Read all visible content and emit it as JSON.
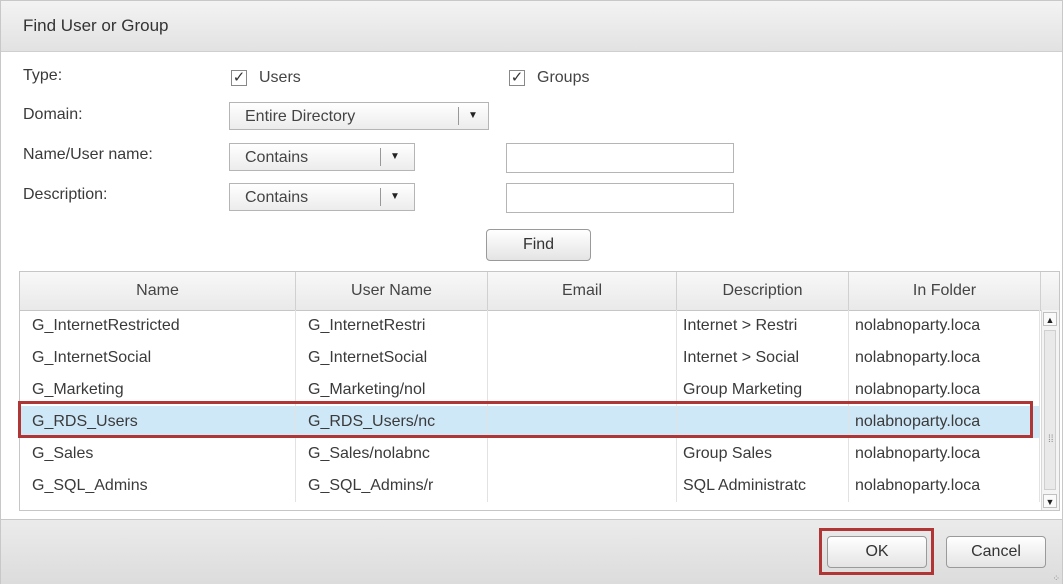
{
  "dialog": {
    "title": "Find User or Group"
  },
  "form": {
    "type_label": "Type:",
    "users_label": "Users",
    "users_checked": true,
    "groups_label": "Groups",
    "groups_checked": true,
    "domain_label": "Domain:",
    "domain_value": "Entire Directory",
    "name_label": "Name/User name:",
    "name_operator": "Contains",
    "name_value": "",
    "description_label": "Description:",
    "description_operator": "Contains",
    "description_value": "",
    "find_label": "Find",
    "checkmark": "✓",
    "dropdown_arrow": "▼"
  },
  "grid": {
    "columns": [
      "Name",
      "User Name",
      "Email",
      "Description",
      "In Folder"
    ],
    "rows": [
      {
        "name": "G_InternetRestricted",
        "user_name": "G_InternetRestri",
        "email": "",
        "description": "Internet > Restri",
        "folder": "nolabnoparty.loca",
        "selected": false
      },
      {
        "name": "G_InternetSocial",
        "user_name": "G_InternetSocial",
        "email": "",
        "description": "Internet > Social",
        "folder": "nolabnoparty.loca",
        "selected": false
      },
      {
        "name": "G_Marketing",
        "user_name": "G_Marketing/nol",
        "email": "",
        "description": "Group Marketing",
        "folder": "nolabnoparty.loca",
        "selected": false
      },
      {
        "name": "G_RDS_Users",
        "user_name": "G_RDS_Users/nc",
        "email": "",
        "description": "",
        "folder": "nolabnoparty.loca",
        "selected": true
      },
      {
        "name": "G_Sales",
        "user_name": "G_Sales/nolabnc",
        "email": "",
        "description": "Group Sales",
        "folder": "nolabnoparty.loca",
        "selected": false
      },
      {
        "name": "G_SQL_Admins",
        "user_name": "G_SQL_Admins/r",
        "email": "",
        "description": "SQL Administratc",
        "folder": "nolabnoparty.loca",
        "selected": false
      }
    ],
    "scroll_up": "▲",
    "scroll_down": "▼"
  },
  "footer": {
    "ok_label": "OK",
    "cancel_label": "Cancel"
  },
  "colors": {
    "selection": "#cfe8f8",
    "highlight_box": "#b03636"
  }
}
